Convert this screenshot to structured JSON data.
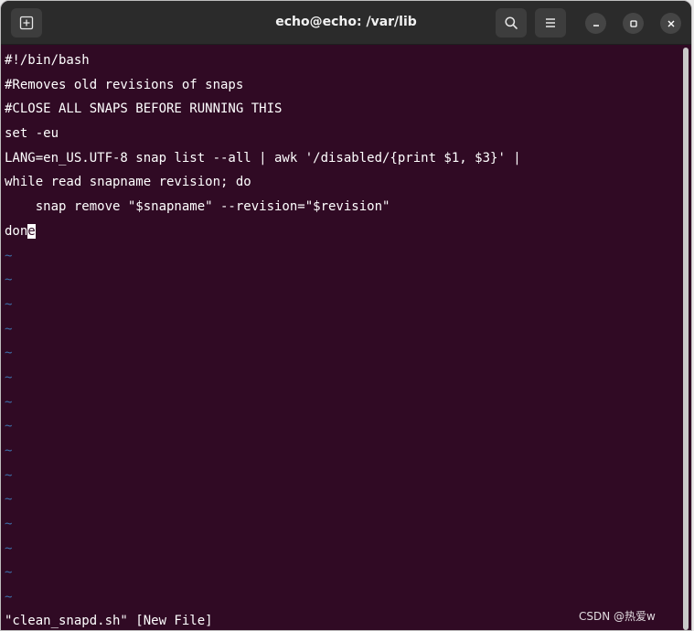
{
  "window": {
    "title": "echo@echo: /var/lib"
  },
  "titlebar": {
    "new_tab_icon": "new-tab-icon",
    "search_icon": "search-icon",
    "menu_icon": "hamburger-menu-icon",
    "minimize_icon": "minimize-icon",
    "maximize_icon": "maximize-icon",
    "close_icon": "close-icon"
  },
  "editor": {
    "lines": [
      "#!/bin/bash",
      "#Removes old revisions of snaps",
      "#CLOSE ALL SNAPS BEFORE RUNNING THIS",
      "set -eu",
      "LANG=en_US.UTF-8 snap list --all | awk '/disabled/{print $1, $3}' |",
      "while read snapname revision; do",
      "    snap remove \"$snapname\" --revision=\"$revision\""
    ],
    "last_line_before_cursor": "don",
    "cursor_char": "e",
    "tilde": "~",
    "empty_line_count": 15
  },
  "status_line": "\"clean_snapd.sh\" [New File]",
  "watermark": "CSDN @热爱w",
  "colors": {
    "terminal_bg": "#300a24",
    "titlebar_bg": "#2b2b2b",
    "tilde": "#3d6fa8"
  }
}
